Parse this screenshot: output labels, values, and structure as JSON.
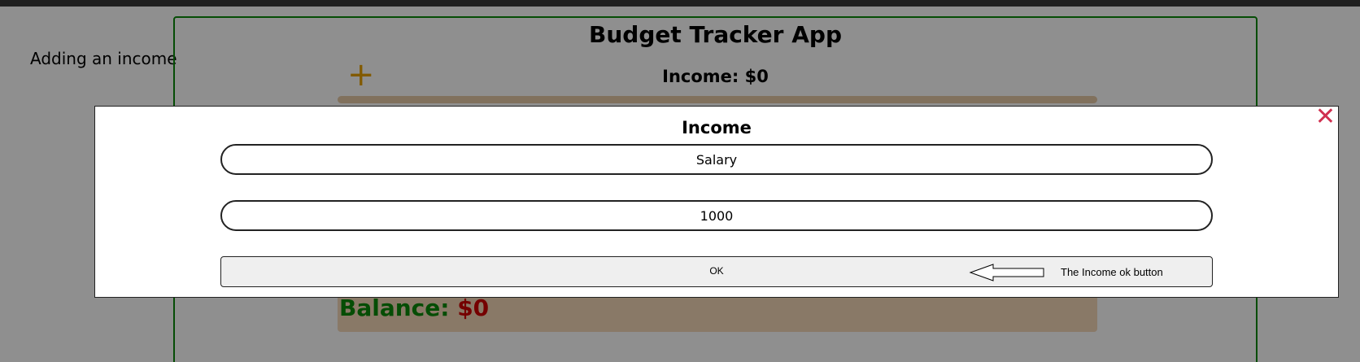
{
  "side_caption": "Adding an income",
  "app": {
    "title": "Budget Tracker App",
    "add_icon_glyph": "+",
    "income_label": "Income: $0",
    "balance_label": "Balance: ",
    "balance_value": "$0",
    "colors": {
      "accent": "#e8a000",
      "border": "#0a8a0a",
      "balance_label": "#0a8a0a",
      "balance_value": "#d00000"
    }
  },
  "modal": {
    "title": "Income",
    "close_glyph": "✕",
    "name_field_value": "Salary",
    "amount_field_value": "1000",
    "ok_label": "OK",
    "annotation": "The Income ok button"
  }
}
